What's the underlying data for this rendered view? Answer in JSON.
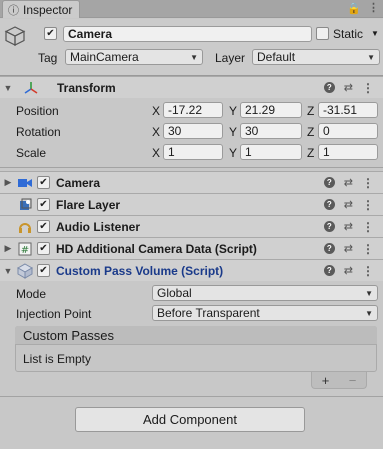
{
  "tab": {
    "label": "Inspector",
    "lock_icon": "lock-icon",
    "menu_icon": "kebab-icon"
  },
  "object": {
    "active": true,
    "name": "Camera",
    "static_label": "Static",
    "tag_label": "Tag",
    "tag_value": "MainCamera",
    "layer_label": "Layer",
    "layer_value": "Default"
  },
  "transform": {
    "title": "Transform",
    "position": {
      "label": "Position",
      "x": "-17.22",
      "y": "21.29",
      "z": "-31.51"
    },
    "rotation": {
      "label": "Rotation",
      "x": "30",
      "y": "30",
      "z": "0"
    },
    "scale": {
      "label": "Scale",
      "x": "1",
      "y": "1",
      "z": "1"
    },
    "axis": {
      "x": "X",
      "y": "Y",
      "z": "Z"
    }
  },
  "components": [
    {
      "title": "Camera",
      "icon": "camera-icon",
      "enabled": true
    },
    {
      "title": "Flare Layer",
      "icon": "flare-layer-icon",
      "enabled": true
    },
    {
      "title": "Audio Listener",
      "icon": "audio-listener-icon",
      "enabled": true
    },
    {
      "title": "HD Additional Camera Data (Script)",
      "icon": "script-icon",
      "enabled": true
    }
  ],
  "custom_pass": {
    "title": "Custom Pass Volume (Script)",
    "mode_label": "Mode",
    "mode_value": "Global",
    "injection_label": "Injection Point",
    "injection_value": "Before Transparent",
    "passes_header": "Custom Passes",
    "passes_empty": "List is Empty",
    "add_symbol": "+",
    "remove_symbol": "−"
  },
  "add_component": "Add Component",
  "colors": {
    "panel": "#c8c8c8",
    "header": "#d0d0d0",
    "accent_blue": "#1a3a8a",
    "transform_icon_red": "#d23b2b",
    "camera_blue": "#2f6bd6"
  }
}
